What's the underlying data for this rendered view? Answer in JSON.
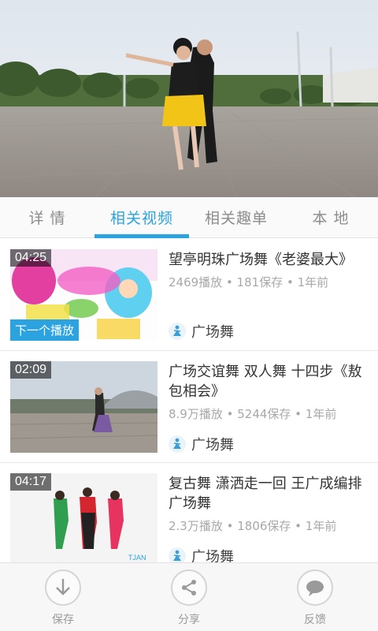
{
  "tabs": [
    {
      "label": "详 情",
      "active": false
    },
    {
      "label": "相关视频",
      "active": true
    },
    {
      "label": "相关趣单",
      "active": false
    },
    {
      "label": "本 地",
      "active": false
    }
  ],
  "videos": [
    {
      "duration": "04:25",
      "badge": "下一个播放",
      "title": "望亭明珠广场舞《老婆最大》",
      "meta": "2469播放 • 181保存 • 1年前",
      "category": "广场舞"
    },
    {
      "duration": "02:09",
      "title": "广场交谊舞 双人舞 十四步《敖包相会》",
      "meta": "8.9万播放 • 5244保存 • 1年前",
      "category": "广场舞"
    },
    {
      "duration": "04:17",
      "title": "复古舞 潇洒走一回 王广成编排广场舞",
      "meta": "2.3万播放 • 1806保存 • 1年前",
      "category": "广场舞"
    }
  ],
  "bottom_bar": [
    {
      "label": "保存",
      "icon": "download-icon"
    },
    {
      "label": "分享",
      "icon": "share-icon"
    },
    {
      "label": "反馈",
      "icon": "feedback-icon"
    }
  ],
  "colors": {
    "accent": "#2aa3e0",
    "muted": "#a8a8a8"
  }
}
